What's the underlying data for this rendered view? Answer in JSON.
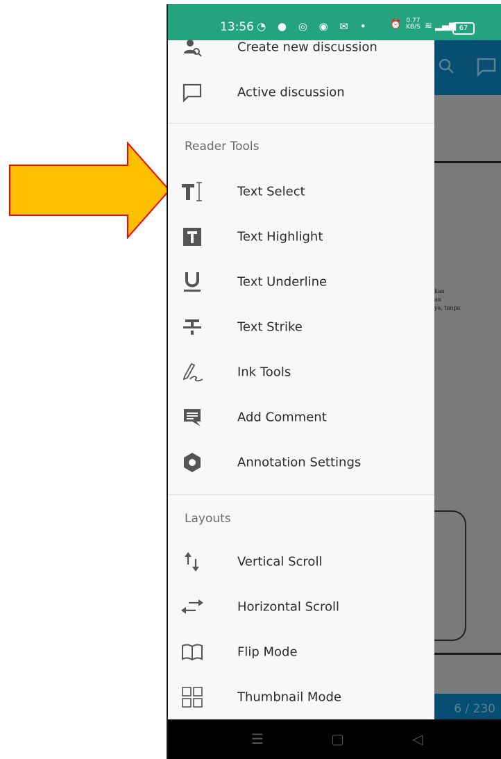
{
  "status_bar": {
    "time": "13:56",
    "net_speed_value": "0.77",
    "net_speed_unit": "KB/S",
    "battery": "67"
  },
  "drawer": {
    "top_items": [
      {
        "label": "Create new discussion",
        "icon": "search-user-icon"
      },
      {
        "label": "Active discussion",
        "icon": "chat-bubble-icon"
      }
    ],
    "reader_tools_title": "Reader Tools",
    "reader_tools": [
      {
        "label": "Text Select",
        "icon": "text-select-icon"
      },
      {
        "label": "Text Highlight",
        "icon": "text-highlight-icon"
      },
      {
        "label": "Text Underline",
        "icon": "text-underline-icon"
      },
      {
        "label": "Text Strike",
        "icon": "text-strike-icon"
      },
      {
        "label": "Ink Tools",
        "icon": "ink-pen-icon"
      },
      {
        "label": "Add Comment",
        "icon": "comment-icon"
      },
      {
        "label": "Annotation Settings",
        "icon": "gear-icon"
      }
    ],
    "layouts_title": "Layouts",
    "layouts": [
      {
        "label": "Vertical Scroll",
        "icon": "vertical-scroll-icon"
      },
      {
        "label": "Horizontal Scroll",
        "icon": "horizontal-scroll-icon"
      },
      {
        "label": "Flip Mode",
        "icon": "book-icon"
      },
      {
        "label": "Thumbnail Mode",
        "icon": "grid-icon"
      }
    ]
  },
  "background_app": {
    "page_indicator": "6 / 230",
    "text_lines": [
      "kan",
      "an",
      "ya, tanpa"
    ]
  },
  "colors": {
    "status_bar": "#23a47f",
    "app_header": "#064f72",
    "arrow_fill": "#ffc000",
    "arrow_stroke": "#ff0000"
  }
}
